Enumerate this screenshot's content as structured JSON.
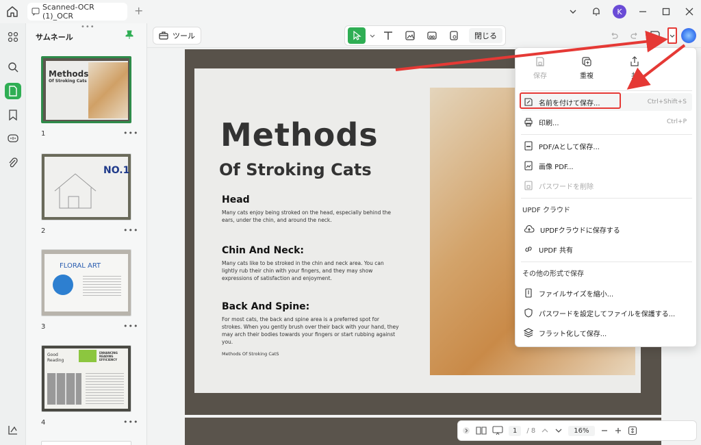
{
  "titlebar": {
    "tab_title": "Scanned-OCR (1)_OCR",
    "avatar_letter": "K"
  },
  "thumbnails": {
    "title": "サムネール",
    "pages": [
      {
        "num": "1",
        "heading": "Methods",
        "sub": "Of Stroking Cats"
      },
      {
        "num": "2",
        "heading": "NO.1"
      },
      {
        "num": "3",
        "heading": "FLORAL ART"
      },
      {
        "num": "4",
        "heading": "Good Reading",
        "sub": "ENHANCING READING EFFICIENCY"
      }
    ]
  },
  "toolbar": {
    "tool_label": "ツール",
    "close_label": "閉じる"
  },
  "document": {
    "title": "Methods",
    "subtitle": "Of Stroking Cats",
    "sections": [
      {
        "heading": "Head",
        "text": "Many cats enjoy being stroked on the head, especially behind the ears, under the chin, and around the neck."
      },
      {
        "heading": "Chin And Neck:",
        "text": "Many cats like to be stroked in the chin and neck area. You can lightly rub their chin with your fingers, and they may show expressions of satisfaction and enjoyment."
      },
      {
        "heading": "Back And Spine:",
        "text": "For most cats, the back and spine area is a preferred spot for strokes. When you gently brush over their back with your hand, they may arch their bodies towards your fingers or start rubbing against you."
      }
    ],
    "footer": "Methods Of Stroking CatS"
  },
  "bottombar": {
    "page_current": "1",
    "page_total": "/ 8",
    "zoom": "16%"
  },
  "menu": {
    "top": {
      "save": "保存",
      "duplicate": "重複",
      "share": "共"
    },
    "items": {
      "save_as": "名前を付けて保存...",
      "save_as_shortcut": "Ctrl+Shift+S",
      "print": "印刷...",
      "print_shortcut": "Ctrl+P",
      "save_pdfa": "PDF/Aとして保存...",
      "image_pdf": "画像 PDF...",
      "remove_password": "パスワードを削除",
      "cloud_header": "UPDF クラウド",
      "save_cloud": "UPDFクラウドに保存する",
      "updf_share": "UPDF 共有",
      "other_header": "その他の形式で保存",
      "compress": "ファイルサイズを縮小...",
      "protect": "パスワードを設定してファイルを保護する...",
      "flatten": "フラット化して保存..."
    }
  },
  "colors": {
    "accent": "#2fae54",
    "highlight_red": "#e53935"
  }
}
